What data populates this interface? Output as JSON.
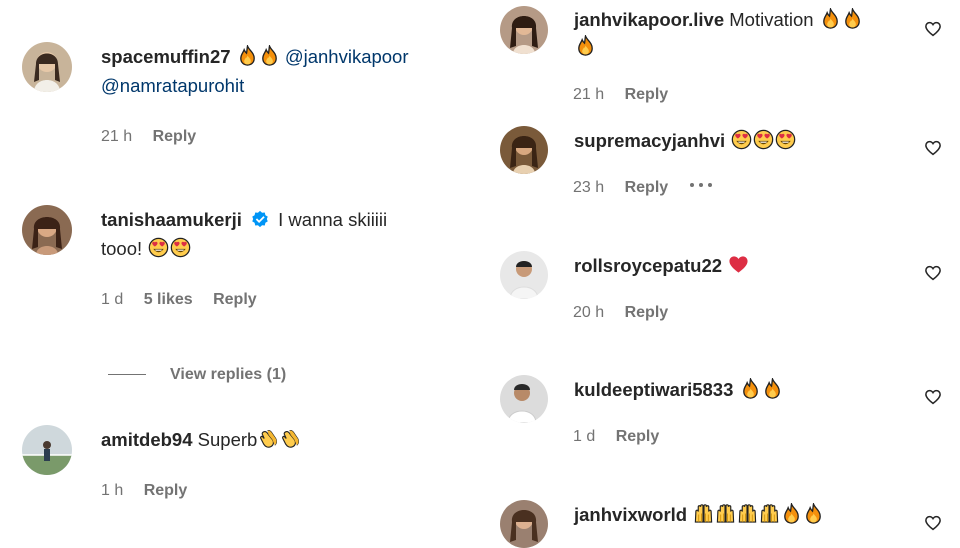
{
  "left_column": {
    "comments": [
      {
        "username": "spacemuffin27",
        "emojis": [
          "fire-emoji",
          "fire-emoji"
        ],
        "mentions": [
          "@janhvikapoor",
          "@namratapurohit"
        ],
        "time": "21 h",
        "reply_label": "Reply"
      },
      {
        "username": "tanishaamukerji",
        "verified": true,
        "text_line1": "I wanna skiiiii",
        "text_line2": "tooo!",
        "emojis": [
          "heart-eyes-emoji",
          "heart-eyes-emoji"
        ],
        "time": "1 d",
        "likes": "5 likes",
        "reply_label": "Reply"
      },
      {
        "username": "amitdeb94",
        "text": "Superb",
        "emojis": [
          "clap-emoji",
          "clap-emoji"
        ],
        "time": "1 h",
        "reply_label": "Reply"
      }
    ],
    "view_replies_label": "View replies (1)"
  },
  "right_column": {
    "comments": [
      {
        "username": "janhvikapoor.live",
        "text": "Motivation",
        "emojis": [
          "fire-emoji",
          "fire-emoji",
          "fire-emoji"
        ],
        "time": "21 h",
        "reply_label": "Reply"
      },
      {
        "username": "supremacyjanhvi",
        "emojis": [
          "heart-eyes-emoji",
          "heart-eyes-emoji",
          "heart-eyes-emoji"
        ],
        "time": "23 h",
        "reply_label": "Reply",
        "more_options": true
      },
      {
        "username": "rollsroycepatu22",
        "emojis": [
          "red-heart-emoji"
        ],
        "time": "20 h",
        "reply_label": "Reply"
      },
      {
        "username": "kuldeeptiwari5833",
        "emojis": [
          "fire-emoji",
          "fire-emoji"
        ],
        "time": "1 d",
        "reply_label": "Reply"
      },
      {
        "username": "janhvixworld",
        "emojis": [
          "raised-hands-emoji",
          "raised-hands-emoji",
          "raised-hands-emoji",
          "raised-hands-emoji",
          "fire-emoji",
          "fire-emoji"
        ]
      }
    ]
  },
  "colors": {
    "username": "#262626",
    "meta": "#737373",
    "mention": "#00376b",
    "verified": "#0095f6"
  }
}
